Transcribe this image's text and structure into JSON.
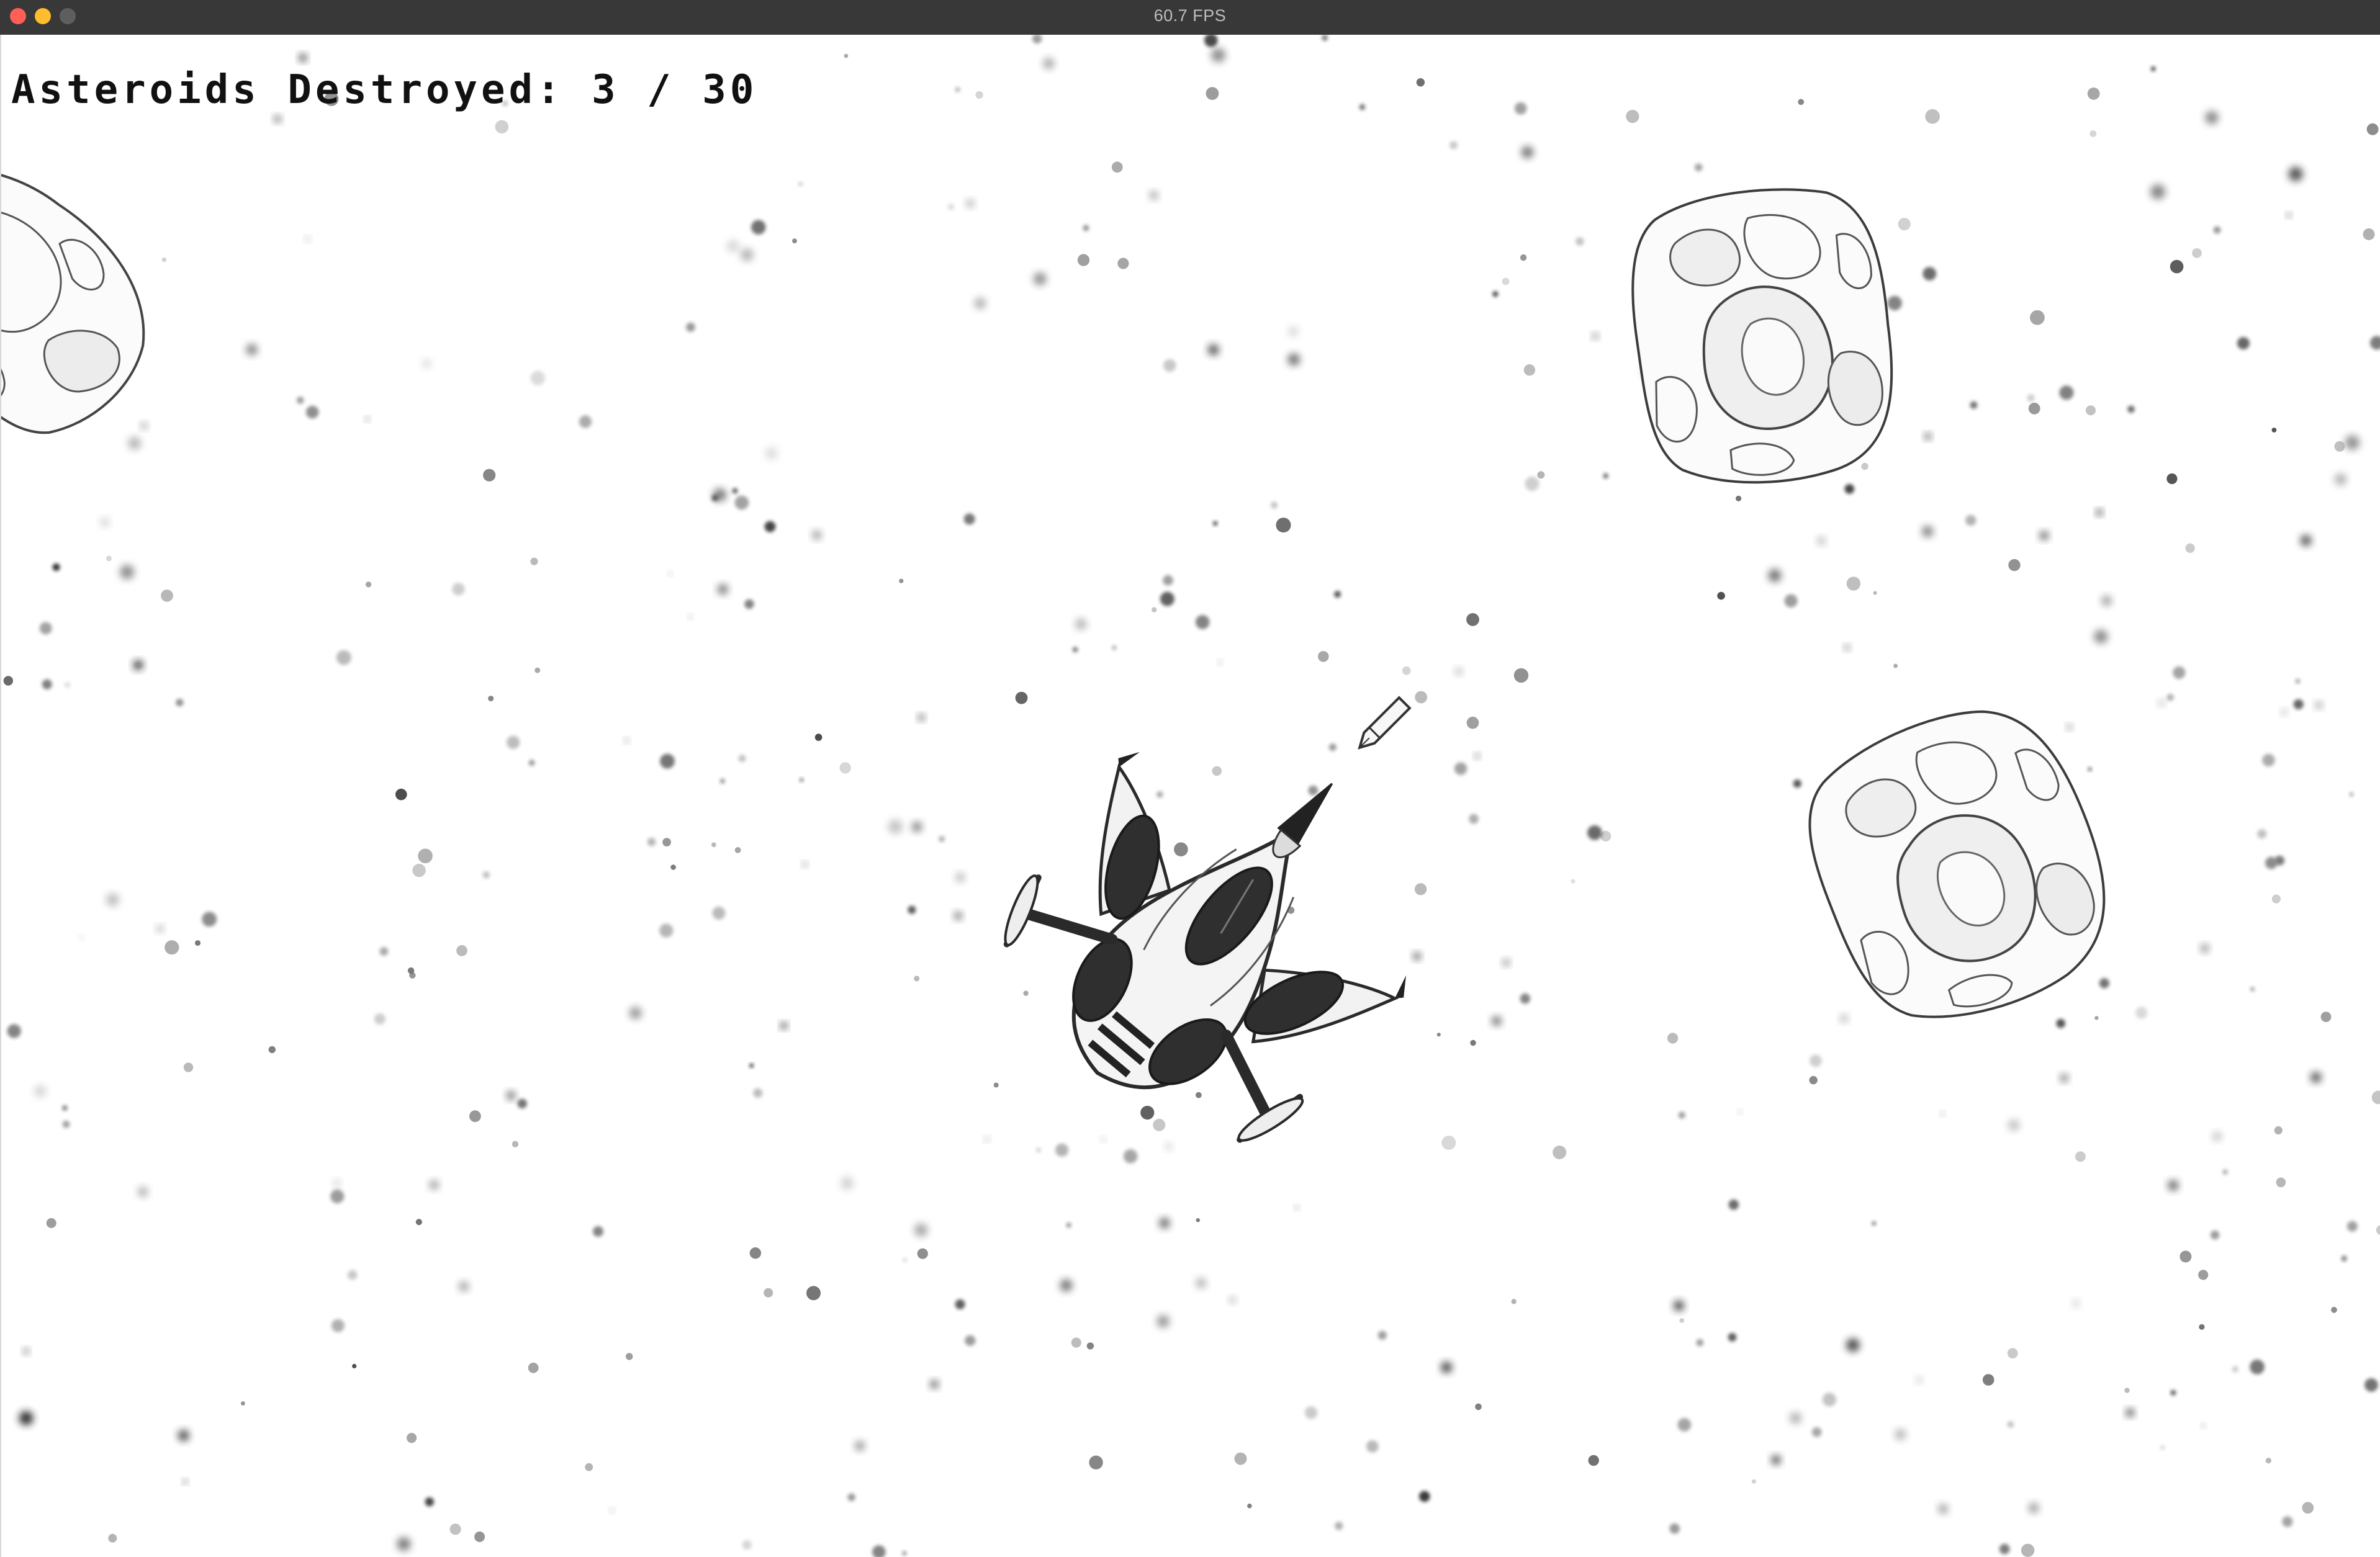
{
  "window": {
    "title": "60.7 FPS"
  },
  "hud": {
    "label": "Asteroids Destroyed:",
    "destroyed": "3",
    "separator": "/",
    "total": "30"
  },
  "game": {
    "asteroid_count_visible": 3,
    "projectile_count_visible": 1,
    "ship_visible": true
  },
  "colors": {
    "background": "#ffffff",
    "titlebar": "#383838",
    "ink": "#222222"
  }
}
